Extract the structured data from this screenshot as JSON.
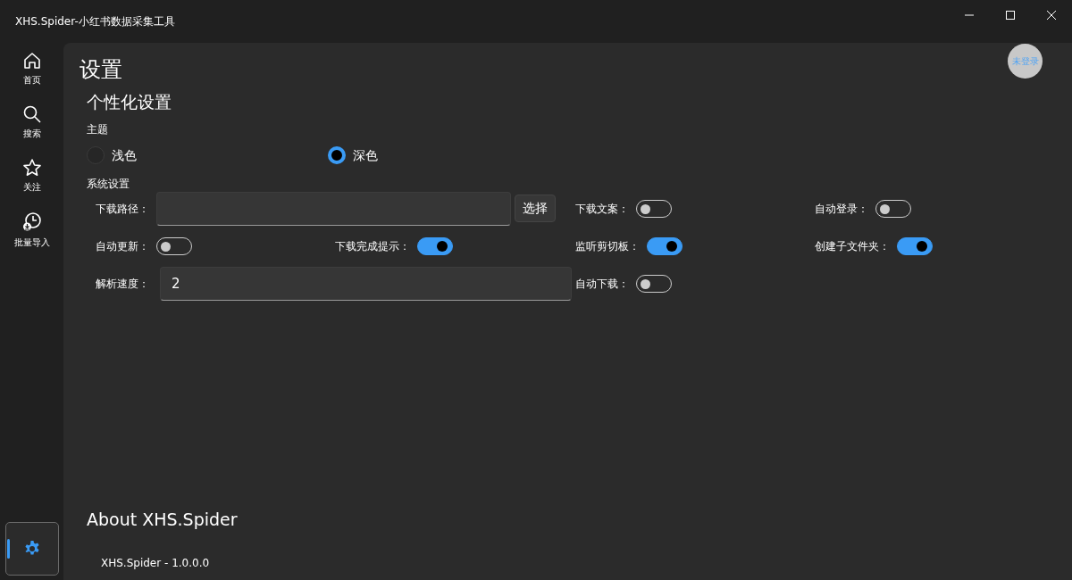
{
  "window": {
    "title": "XHS.Spider-小红书数据采集工具"
  },
  "nav": [
    {
      "kind": "home",
      "label": "首页",
      "selected": false
    },
    {
      "kind": "search",
      "label": "搜索",
      "selected": false
    },
    {
      "kind": "star",
      "label": "关注",
      "selected": false
    },
    {
      "kind": "history",
      "label": "批量导入",
      "selected": false
    }
  ],
  "nav_footer": {
    "kind": "settings",
    "selected": true
  },
  "avatar": {
    "label": "未登录"
  },
  "page_title": "设置",
  "personal": {
    "heading": "个性化设置",
    "theme_label": "主题",
    "themes": [
      {
        "label": "浅色",
        "selected": false
      },
      {
        "label": "深色",
        "selected": true
      }
    ]
  },
  "system": {
    "heading": "系统设置",
    "settings": [
      {
        "kind": "path",
        "label": "下载路径：",
        "button": "选择"
      },
      {
        "kind": "toggle",
        "label": "下载文案：",
        "on": false
      },
      {
        "kind": "toggle",
        "label": "自动登录：",
        "on": false
      },
      {
        "kind": "toggle",
        "label": "自动更新：",
        "on": false
      },
      {
        "kind": "toggle",
        "label": "下载完成提示：",
        "on": true
      },
      {
        "kind": "toggle",
        "label": "监听剪切板：",
        "on": true
      },
      {
        "kind": "toggle",
        "label": "创建子文件夹：",
        "on": true
      },
      {
        "kind": "number",
        "label": "解析速度：",
        "value": "2"
      },
      {
        "kind": "toggle",
        "label": "自动下载：",
        "on": false
      }
    ]
  },
  "about": {
    "heading": "About XHS.Spider",
    "version": "XHS.Spider - 1.0.0.0"
  }
}
